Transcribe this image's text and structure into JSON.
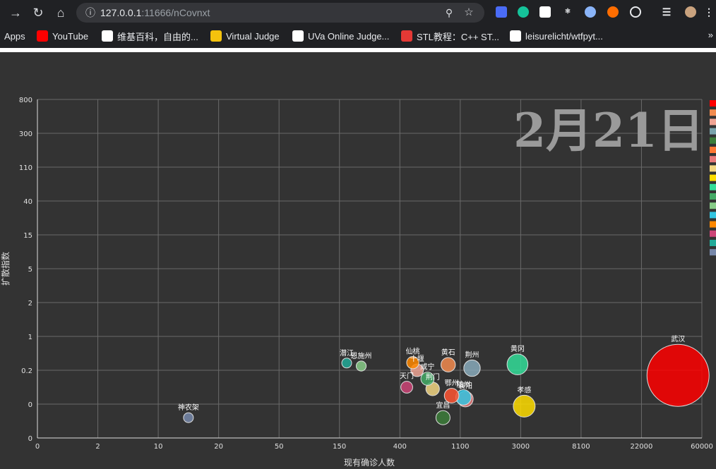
{
  "browser": {
    "url_host": "127.0.0.1",
    "url_rest": ":11666/nCovnxt",
    "bookmarks": [
      {
        "label": "Apps",
        "icon": "apps-grid-icon",
        "color": "#4285f4"
      },
      {
        "label": "YouTube",
        "icon": "youtube-icon",
        "color": "#ff0000"
      },
      {
        "label": "维基百科，自由的...",
        "icon": "wikipedia-icon",
        "color": "#ffffff"
      },
      {
        "label": "Virtual Judge",
        "icon": "virtual-judge-icon",
        "color": "#f4c20d"
      },
      {
        "label": "UVa Online Judge...",
        "icon": "globe-icon",
        "color": "#ffffff"
      },
      {
        "label": "STL教程：C++ ST...",
        "icon": "c-logo-icon",
        "color": "#e53935"
      },
      {
        "label": "leisurelicht/wtfpyt...",
        "icon": "github-icon",
        "color": "#ffffff"
      }
    ],
    "more": "»"
  },
  "chart_data": {
    "type": "scatter",
    "title": "2月21日",
    "xlabel": "现有确诊人数",
    "ylabel": "扩散指数",
    "x_ticks": [
      "0",
      "2",
      "10",
      "20",
      "50",
      "150",
      "400",
      "1100",
      "3000",
      "8100",
      "22000",
      "60000"
    ],
    "y_ticks": [
      "0",
      "0",
      "0.2",
      "1",
      "2",
      "5",
      "15",
      "40",
      "110",
      "300",
      "800"
    ],
    "grid": true,
    "legend": "right",
    "legend_colors": [
      "#ff0000",
      "#f28b4f",
      "#f0a494",
      "#7aa4ac",
      "#3c7d3a",
      "#ff7733",
      "#e87a7a",
      "#f2d682",
      "#ffdd00",
      "#33dd99",
      "#44aa66",
      "#88cc88",
      "#33c4e0",
      "#ff8800",
      "#cc4477",
      "#22aa99",
      "#7788aa"
    ],
    "points": [
      {
        "name": "武汉",
        "x": 45000,
        "y": 0.17,
        "color": "#ff0000"
      },
      {
        "name": "孝感",
        "x": 3300,
        "y": -0.06,
        "color": "#ffdd00"
      },
      {
        "name": "黄冈",
        "x": 2900,
        "y": 0.34,
        "color": "#33dd99"
      },
      {
        "name": "荆州",
        "x": 1470,
        "y": 0.25,
        "color": "#88aabb"
      },
      {
        "name": "黄石",
        "x": 960,
        "y": 0.33,
        "color": "#f28b4f"
      },
      {
        "name": "仙桃",
        "x": 550,
        "y": 0.38,
        "color": "#ff8800"
      },
      {
        "name": "十堰",
        "x": 600,
        "y": 0.2,
        "color": "#f0a494"
      },
      {
        "name": "咸宁",
        "x": 720,
        "y": 0.15,
        "color": "#44aa66"
      },
      {
        "name": "荆门",
        "x": 780,
        "y": 0.09,
        "color": "#f2d682"
      },
      {
        "name": "随州",
        "x": 1200,
        "y": 0.04,
        "color": "#33c4e0"
      },
      {
        "name": "襄阳",
        "x": 1260,
        "y": 0.03,
        "color": "#e87a7a"
      },
      {
        "name": "鄂州",
        "x": 1000,
        "y": 0.05,
        "color": "#ff5533"
      },
      {
        "name": "天门",
        "x": 480,
        "y": 0.1,
        "color": "#cc4477"
      },
      {
        "name": "潜江",
        "x": 180,
        "y": 0.37,
        "color": "#22aa99"
      },
      {
        "name": "恩施州",
        "x": 240,
        "y": 0.3,
        "color": "#88cc88"
      },
      {
        "name": "宜昌",
        "x": 900,
        "y": -0.4,
        "color": "#3c7d3a"
      },
      {
        "name": "神农架",
        "x": 15,
        "y": -0.4,
        "color": "#7788aa"
      }
    ]
  }
}
